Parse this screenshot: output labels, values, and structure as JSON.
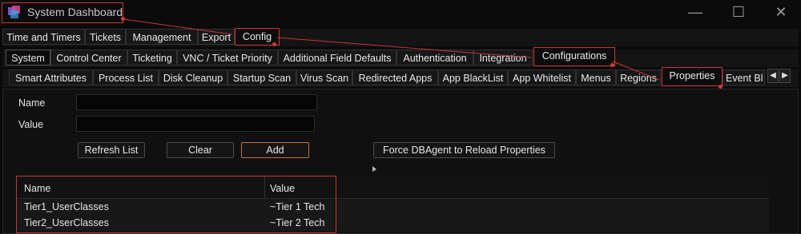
{
  "window": {
    "title": "System Dashboard"
  },
  "main_tabs": [
    "Time and Timers",
    "Tickets",
    "Management",
    "Export",
    "Config"
  ],
  "config_tabs": [
    "System",
    "Control Center",
    "Ticketing",
    "VNC / Ticket Priority",
    "Additional Field Defaults",
    "Authentication",
    "Integration",
    "Configurations"
  ],
  "config_subtabs": [
    "Smart Attributes",
    "Process List",
    "Disk Cleanup",
    "Startup Scan",
    "Virus Scan",
    "Redirected Apps",
    "App BlackList",
    "App Whitelist",
    "Menus",
    "Regions",
    "Properties",
    "Event Bl"
  ],
  "form": {
    "name_label": "Name",
    "value_label": "Value",
    "name_value": "",
    "value_value": ""
  },
  "buttons": {
    "refresh": "Refresh List",
    "clear": "Clear",
    "add": "Add",
    "force_reload": "Force DBAgent to Reload Properties"
  },
  "grid": {
    "columns": [
      "Name",
      "Value"
    ],
    "rows": [
      {
        "name": "Tier1_UserClasses",
        "value": "~Tier 1 Tech"
      },
      {
        "name": "Tier2_UserClasses",
        "value": "~Tier 2 Tech"
      }
    ]
  },
  "colors": {
    "annotation": "#c8373a",
    "add_border": "#c8703a"
  }
}
